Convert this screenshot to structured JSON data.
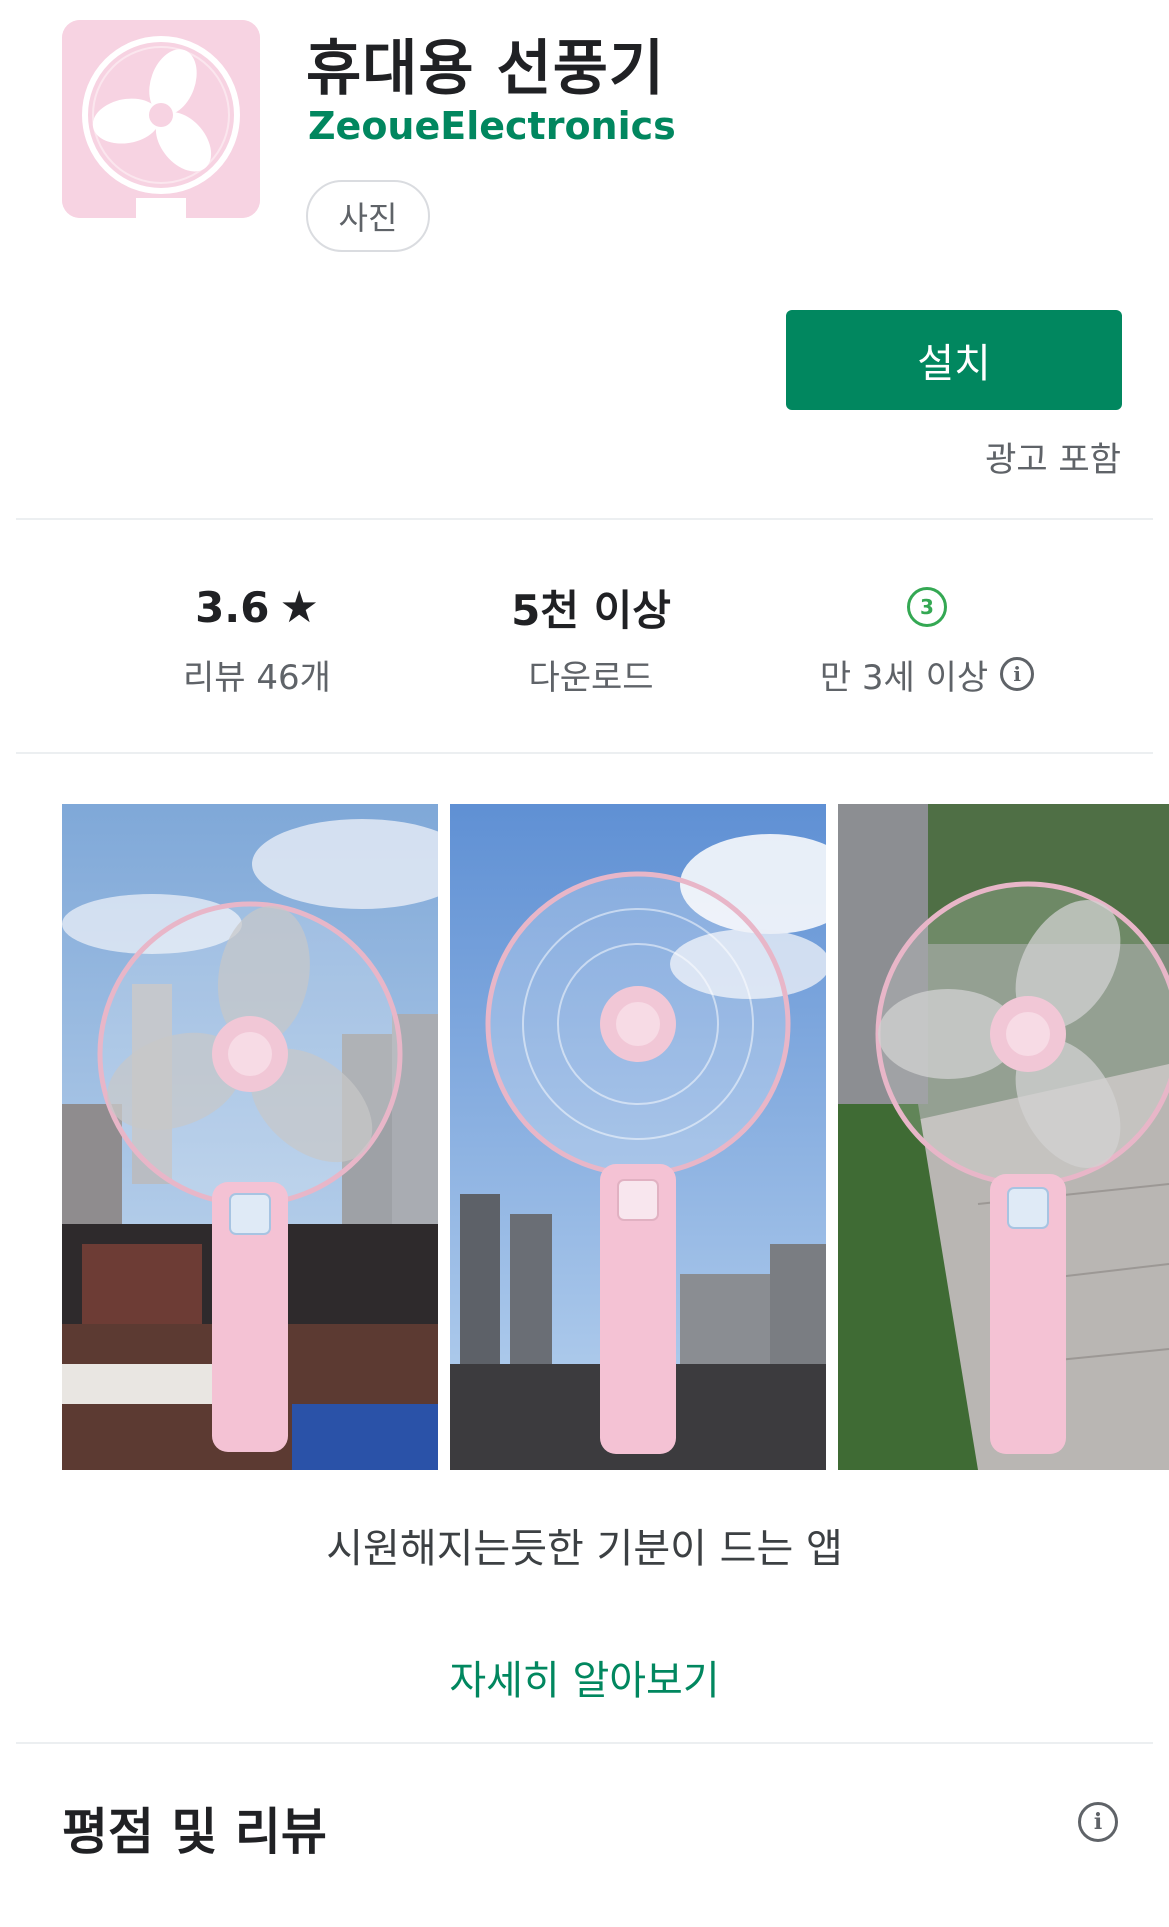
{
  "app": {
    "title": "휴대용 선풍기",
    "developer": "ZeoueElectronics",
    "category_chip": "사진",
    "install_label": "설치",
    "ads_note": "광고 포함"
  },
  "stats": {
    "rating": {
      "value": "3.6",
      "label": "리뷰 46개",
      "icon": "star-icon"
    },
    "downloads": {
      "value": "5천 이상",
      "label": "다운로드"
    },
    "age": {
      "badge": "3",
      "label": "만 3세 이상",
      "icon": "info-icon"
    }
  },
  "screenshots": [
    {
      "name": "fan-screenshot-city"
    },
    {
      "name": "fan-screenshot-sky"
    },
    {
      "name": "fan-screenshot-sidewalk"
    }
  ],
  "description": {
    "tagline": "시원해지는듯한 기분이 드는 앱",
    "learn_more": "자세히 알아보기"
  },
  "ratings_section": {
    "title": "평점 및 리뷰",
    "icon": "info-icon"
  },
  "colors": {
    "accent": "#01875f",
    "icon_bg": "#f7d3e2",
    "fan_pink": "#f4c2d4"
  }
}
